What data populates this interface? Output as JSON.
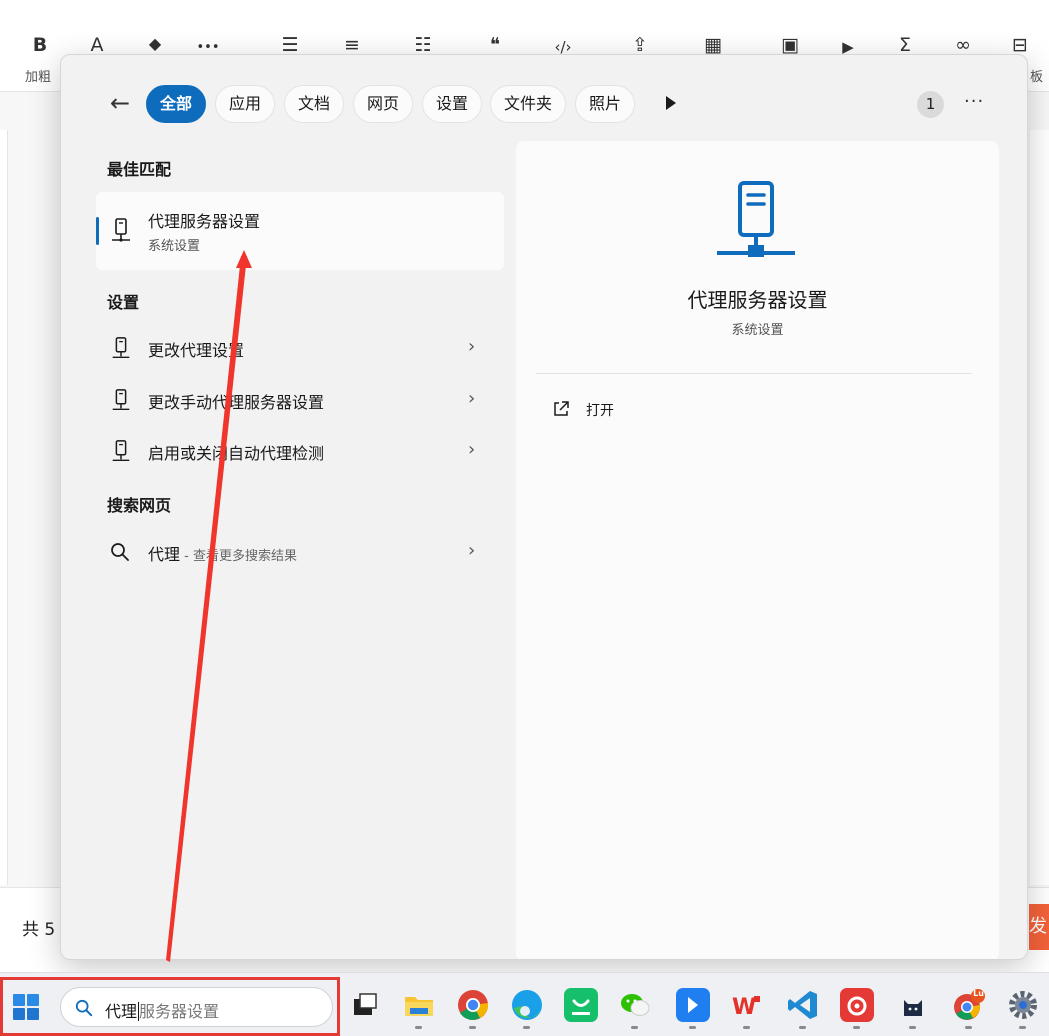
{
  "background": {
    "toolbar_icons": [
      "B",
      "A",
      "◆",
      "•••",
      "☰",
      "≡",
      "☷",
      "❝",
      "‹/›",
      "⇪",
      "▦",
      "▣",
      "▶",
      "Σ",
      "∞",
      "⊟"
    ],
    "bold_label": "加粗",
    "right_label_fragment": "板",
    "count_fragment": "共 5",
    "publish_fragment": "发布"
  },
  "search": {
    "chips": [
      "全部",
      "应用",
      "文档",
      "网页",
      "设置",
      "文件夹",
      "照片"
    ],
    "result_count": "1",
    "more_label": "···",
    "best_match_heading": "最佳匹配",
    "best_match": {
      "title": "代理服务器设置",
      "subtitle": "系统设置"
    },
    "settings_heading": "设置",
    "settings_items": [
      "更改代理设置",
      "更改手动代理服务器设置",
      "启用或关闭自动代理检测"
    ],
    "web_heading": "搜索网页",
    "web_item": {
      "query": "代理",
      "suffix": " - 查看更多搜索结果"
    },
    "detail": {
      "title": "代理服务器设置",
      "subtitle": "系统设置",
      "action_open": "打开"
    }
  },
  "taskbar": {
    "search_typed": "代理",
    "search_suggestion": "服务器设置",
    "apps": [
      "task-view",
      "file-explorer",
      "chrome",
      "edge",
      "store",
      "wechat",
      "feishu",
      "wps",
      "vscode",
      "netease-music",
      "cat-app",
      "chrome-profile",
      "settings"
    ],
    "chrome_profile_badge": "Lu"
  },
  "colors": {
    "accent": "#0f6cbd",
    "annotation": "#e53935"
  }
}
